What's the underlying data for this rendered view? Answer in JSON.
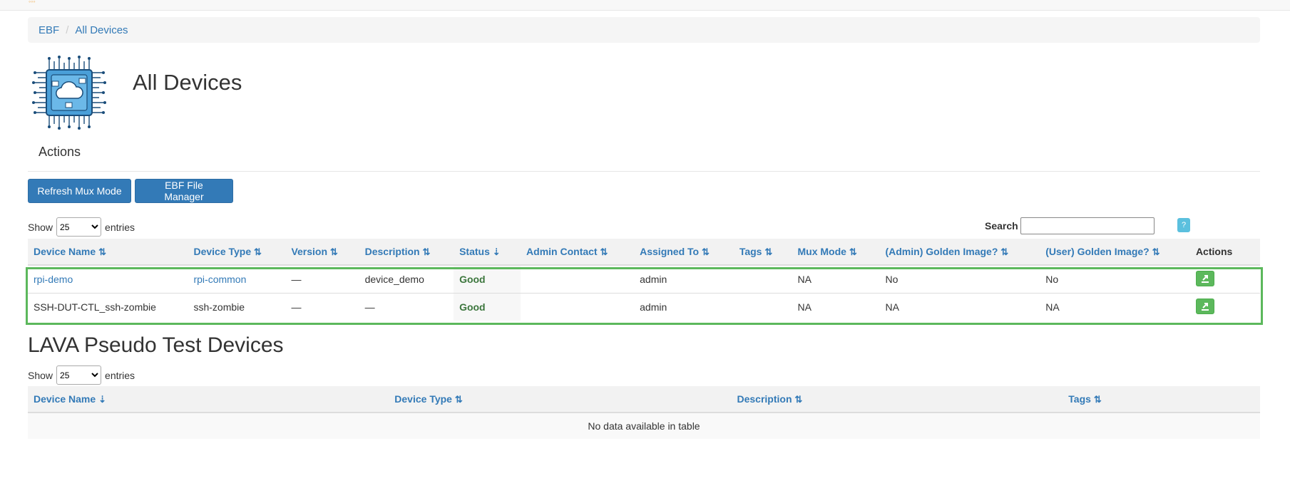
{
  "breadcrumb": {
    "root": "EBF",
    "separator": "/",
    "current": "All Devices"
  },
  "page": {
    "title": "All Devices",
    "actions_heading": "Actions"
  },
  "buttons": {
    "refresh_mux": "Refresh Mux Mode",
    "file_manager": "EBF File Manager"
  },
  "devices_table": {
    "show_label": "Show",
    "entries_label": "entries",
    "page_length": "25",
    "search_label": "Search",
    "search_value": "",
    "help_label": "?",
    "columns": [
      "Device Name",
      "Device Type",
      "Version",
      "Description",
      "Status",
      "Admin Contact",
      "Assigned To",
      "Tags",
      "Mux Mode",
      "(Admin) Golden Image?",
      "(User) Golden Image?",
      "Actions"
    ],
    "sort_icons": [
      "⇅",
      "⇅",
      "⇅",
      "⇅",
      "⇣",
      "⇅",
      "⇅",
      "⇅",
      "⇅",
      "⇅",
      "⇅"
    ],
    "rows": [
      {
        "name": "rpi-demo",
        "type": "rpi-common",
        "version": "—",
        "description": "device_demo",
        "status": "Good",
        "admin_contact": "",
        "assigned_to": "admin",
        "tags": "",
        "mux_mode": "NA",
        "admin_golden": "No",
        "user_golden": "No"
      },
      {
        "name": "SSH-DUT-CTL_ssh-zombie",
        "type": "ssh-zombie",
        "version": "—",
        "description": "—",
        "status": "Good",
        "admin_contact": "",
        "assigned_to": "admin",
        "tags": "",
        "mux_mode": "NA",
        "admin_golden": "NA",
        "user_golden": "NA"
      }
    ]
  },
  "lava_section": {
    "title": "LAVA Pseudo Test Devices",
    "show_label": "Show",
    "entries_label": "entries",
    "page_length": "25",
    "columns": [
      "Device Name",
      "Device Type",
      "Description",
      "Tags"
    ],
    "sort_icons": [
      "⇣",
      "⇅",
      "⇅",
      "⇅"
    ],
    "empty_message": "No data available in table"
  },
  "colors": {
    "primary": "#337ab7",
    "success": "#5cb85c",
    "good_text": "#3c763d",
    "info": "#5bc0de"
  }
}
